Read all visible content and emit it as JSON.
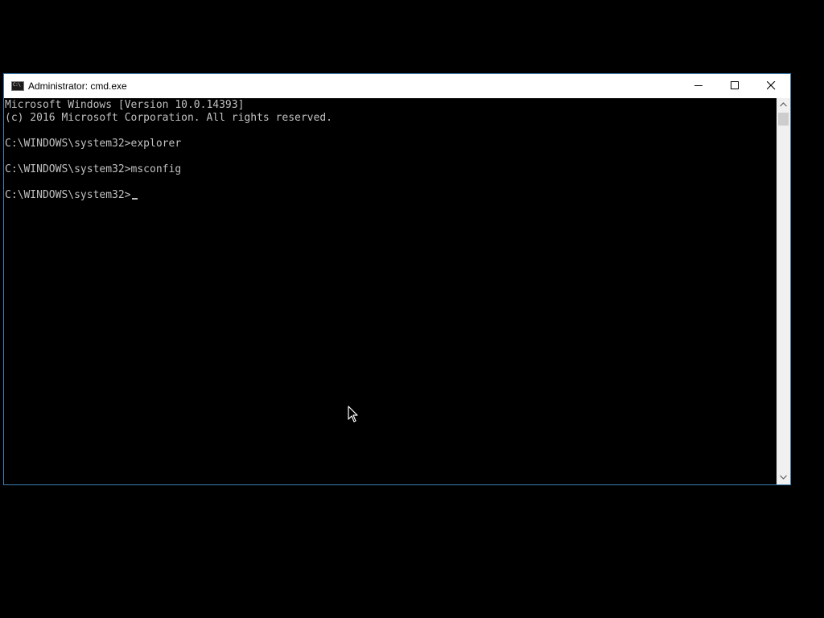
{
  "window": {
    "title": "Administrator: cmd.exe",
    "icon_text": "C:\\",
    "controls": {
      "minimize": "minimize-icon",
      "maximize": "maximize-icon",
      "close": "close-icon"
    }
  },
  "console": {
    "lines": [
      "Microsoft Windows [Version 10.0.14393]",
      "(c) 2016 Microsoft Corporation. All rights reserved.",
      "C:\\WINDOWS\\system32>explorer",
      "C:\\WINDOWS\\system32>msconfig",
      "C:\\WINDOWS\\system32>"
    ]
  },
  "colors": {
    "console_background": "#000000",
    "console_text": "#c0c0c0",
    "titlebar_background": "#ffffff",
    "window_border": "#3c7fb1"
  }
}
